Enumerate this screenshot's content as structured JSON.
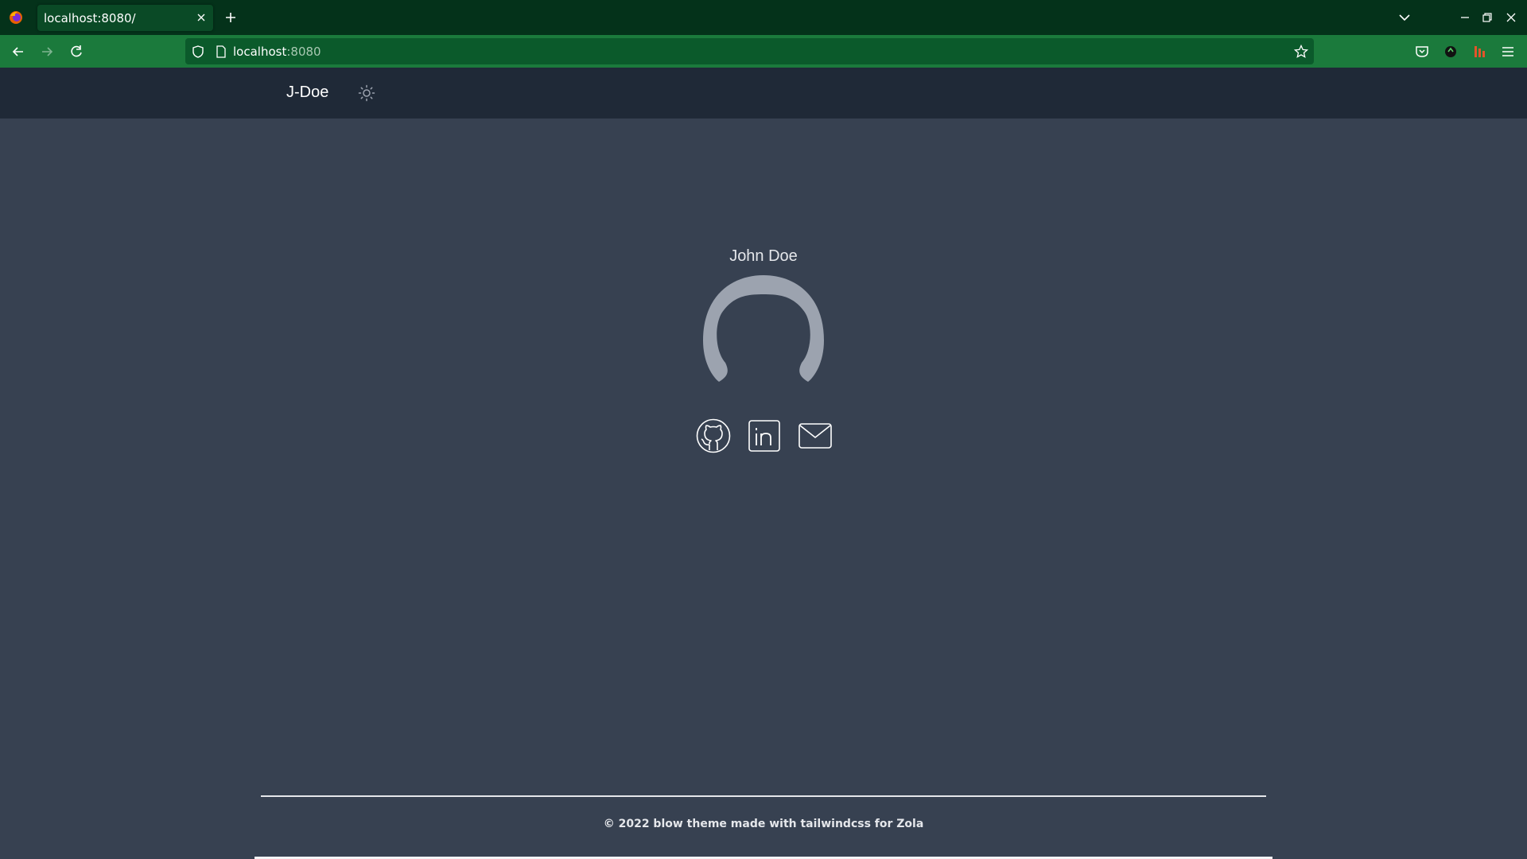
{
  "browser": {
    "tab_title": "localhost:8080/",
    "url_host": "localhost",
    "url_port": ":8080",
    "icons": [
      "firefox-logo",
      "close-icon",
      "plus-icon",
      "chevron-down-icon",
      "minimize-icon",
      "restore-icon",
      "close-icon",
      "back-arrow-icon",
      "forward-arrow-icon",
      "reload-icon",
      "shield-icon",
      "page-icon",
      "star-icon",
      "pocket-icon",
      "extension-icon",
      "extension-icon",
      "hamburger-menu-icon"
    ],
    "colors": {
      "tabbar": "#04321a",
      "toolbar": "#1b7a3c",
      "urlbar": "#0b5a2b"
    }
  },
  "header": {
    "brand": "J-Doe",
    "theme_toggle_icon": "sun-icon"
  },
  "profile": {
    "name": "John Doe",
    "avatar_icon": "default-avatar-icon"
  },
  "socials": [
    {
      "name": "github",
      "icon": "github-icon"
    },
    {
      "name": "linkedin",
      "icon": "linkedin-icon"
    },
    {
      "name": "email",
      "icon": "mail-icon"
    }
  ],
  "footer": {
    "text": "© 2022 blow theme made with tailwindcss for Zola"
  },
  "colors": {
    "page_bg": "#374151",
    "header_bg": "#1f2937",
    "text": "#e5e7eb",
    "avatar": "#9ca3af"
  }
}
